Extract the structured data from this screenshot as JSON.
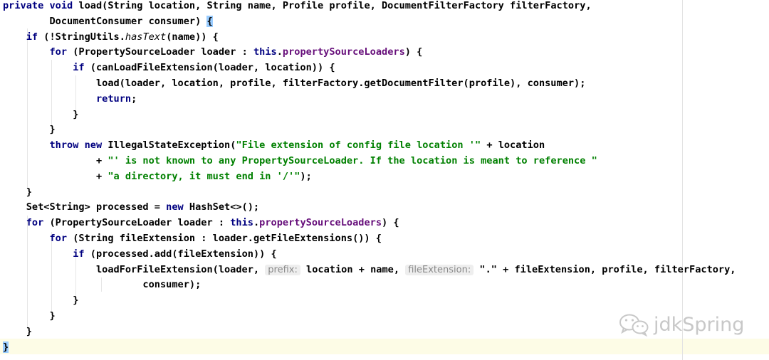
{
  "editor": {
    "lines": [
      [
        {
          "t": "private",
          "c": "kw"
        },
        {
          "t": " "
        },
        {
          "t": "void",
          "c": "kw"
        },
        {
          "t": " load(String location, String name, Profile profile, DocumentFilterFactory filterFactory,"
        }
      ],
      [
        {
          "t": "        DocumentConsumer consumer) "
        },
        {
          "t": "{",
          "c": "brace-hl"
        }
      ],
      [
        {
          "t": "    "
        },
        {
          "t": "if",
          "c": "kw"
        },
        {
          "t": " (!StringUtils."
        },
        {
          "t": "hasText",
          "c": "it"
        },
        {
          "t": "(name)) {"
        }
      ],
      [
        {
          "t": "        "
        },
        {
          "t": "for",
          "c": "kw"
        },
        {
          "t": " (PropertySourceLoader loader : "
        },
        {
          "t": "this",
          "c": "kw"
        },
        {
          "t": "."
        },
        {
          "t": "propertySourceLoaders",
          "c": "fld"
        },
        {
          "t": ") {"
        }
      ],
      [
        {
          "t": "            "
        },
        {
          "t": "if",
          "c": "kw"
        },
        {
          "t": " (canLoadFileExtension(loader, location)) {"
        }
      ],
      [
        {
          "t": "                load(loader, location, profile, filterFactory.getDocumentFilter(profile), consumer);"
        }
      ],
      [
        {
          "t": "                "
        },
        {
          "t": "return",
          "c": "kw"
        },
        {
          "t": ";"
        }
      ],
      [
        {
          "t": "            }"
        }
      ],
      [
        {
          "t": "        }"
        }
      ],
      [
        {
          "t": "        "
        },
        {
          "t": "throw",
          "c": "kw"
        },
        {
          "t": " "
        },
        {
          "t": "new",
          "c": "kw"
        },
        {
          "t": " IllegalStateException("
        },
        {
          "t": "\"File extension of config file location '\"",
          "c": "str"
        },
        {
          "t": " + location"
        }
      ],
      [
        {
          "t": "                + "
        },
        {
          "t": "\"' is not known to any PropertySourceLoader. If the location is meant to reference \"",
          "c": "str"
        }
      ],
      [
        {
          "t": "                + "
        },
        {
          "t": "\"a directory, it must end in '/'\"",
          "c": "str"
        },
        {
          "t": ");"
        }
      ],
      [
        {
          "t": "    }"
        }
      ],
      [
        {
          "t": "    Set<String> processed = "
        },
        {
          "t": "new",
          "c": "kw"
        },
        {
          "t": " HashSet<>();"
        }
      ],
      [
        {
          "t": "    "
        },
        {
          "t": "for",
          "c": "kw"
        },
        {
          "t": " (PropertySourceLoader loader : "
        },
        {
          "t": "this",
          "c": "kw"
        },
        {
          "t": "."
        },
        {
          "t": "propertySourceLoaders",
          "c": "fld"
        },
        {
          "t": ") {"
        }
      ],
      [
        {
          "t": "        "
        },
        {
          "t": "for",
          "c": "kw"
        },
        {
          "t": " (String fileExtension : loader.getFileExtensions()) {"
        }
      ],
      [
        {
          "t": "            "
        },
        {
          "t": "if",
          "c": "kw"
        },
        {
          "t": " (processed.add(fileExtension)) {"
        }
      ],
      [
        {
          "t": "                loadForFileExtension(loader, "
        },
        {
          "t": "prefix:",
          "c": "hint"
        },
        {
          "t": " location + name, "
        },
        {
          "t": "fileExtension:",
          "c": "hint"
        },
        {
          "t": " \".\" + fileExtension, profile, filterFactory,"
        }
      ],
      [
        {
          "t": "                        consumer);"
        }
      ],
      [
        {
          "t": "            }"
        }
      ],
      [
        {
          "t": "        }"
        }
      ],
      [
        {
          "t": "    }"
        }
      ],
      [
        {
          "t": "}",
          "c": "brace-hl"
        }
      ]
    ]
  },
  "watermark": {
    "text": "jdkSpring",
    "icon": "wechat-icon"
  },
  "colors": {
    "keyword": "#000080",
    "string": "#008000",
    "field": "#660e7a",
    "caret_line": "#fdfce6",
    "brace_highlight": "#99ccff"
  }
}
